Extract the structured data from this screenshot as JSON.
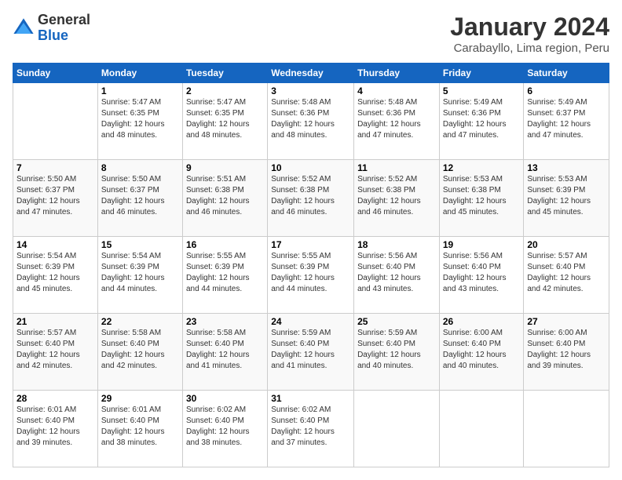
{
  "logo": {
    "line1": "General",
    "line2": "Blue"
  },
  "title": "January 2024",
  "subtitle": "Carabayllo, Lima region, Peru",
  "days_header": [
    "Sunday",
    "Monday",
    "Tuesday",
    "Wednesday",
    "Thursday",
    "Friday",
    "Saturday"
  ],
  "weeks": [
    [
      {
        "num": "",
        "info": ""
      },
      {
        "num": "1",
        "info": "Sunrise: 5:47 AM\nSunset: 6:35 PM\nDaylight: 12 hours\nand 48 minutes."
      },
      {
        "num": "2",
        "info": "Sunrise: 5:47 AM\nSunset: 6:35 PM\nDaylight: 12 hours\nand 48 minutes."
      },
      {
        "num": "3",
        "info": "Sunrise: 5:48 AM\nSunset: 6:36 PM\nDaylight: 12 hours\nand 48 minutes."
      },
      {
        "num": "4",
        "info": "Sunrise: 5:48 AM\nSunset: 6:36 PM\nDaylight: 12 hours\nand 47 minutes."
      },
      {
        "num": "5",
        "info": "Sunrise: 5:49 AM\nSunset: 6:36 PM\nDaylight: 12 hours\nand 47 minutes."
      },
      {
        "num": "6",
        "info": "Sunrise: 5:49 AM\nSunset: 6:37 PM\nDaylight: 12 hours\nand 47 minutes."
      }
    ],
    [
      {
        "num": "7",
        "info": "Sunrise: 5:50 AM\nSunset: 6:37 PM\nDaylight: 12 hours\nand 47 minutes."
      },
      {
        "num": "8",
        "info": "Sunrise: 5:50 AM\nSunset: 6:37 PM\nDaylight: 12 hours\nand 46 minutes."
      },
      {
        "num": "9",
        "info": "Sunrise: 5:51 AM\nSunset: 6:38 PM\nDaylight: 12 hours\nand 46 minutes."
      },
      {
        "num": "10",
        "info": "Sunrise: 5:52 AM\nSunset: 6:38 PM\nDaylight: 12 hours\nand 46 minutes."
      },
      {
        "num": "11",
        "info": "Sunrise: 5:52 AM\nSunset: 6:38 PM\nDaylight: 12 hours\nand 46 minutes."
      },
      {
        "num": "12",
        "info": "Sunrise: 5:53 AM\nSunset: 6:38 PM\nDaylight: 12 hours\nand 45 minutes."
      },
      {
        "num": "13",
        "info": "Sunrise: 5:53 AM\nSunset: 6:39 PM\nDaylight: 12 hours\nand 45 minutes."
      }
    ],
    [
      {
        "num": "14",
        "info": "Sunrise: 5:54 AM\nSunset: 6:39 PM\nDaylight: 12 hours\nand 45 minutes."
      },
      {
        "num": "15",
        "info": "Sunrise: 5:54 AM\nSunset: 6:39 PM\nDaylight: 12 hours\nand 44 minutes."
      },
      {
        "num": "16",
        "info": "Sunrise: 5:55 AM\nSunset: 6:39 PM\nDaylight: 12 hours\nand 44 minutes."
      },
      {
        "num": "17",
        "info": "Sunrise: 5:55 AM\nSunset: 6:39 PM\nDaylight: 12 hours\nand 44 minutes."
      },
      {
        "num": "18",
        "info": "Sunrise: 5:56 AM\nSunset: 6:40 PM\nDaylight: 12 hours\nand 43 minutes."
      },
      {
        "num": "19",
        "info": "Sunrise: 5:56 AM\nSunset: 6:40 PM\nDaylight: 12 hours\nand 43 minutes."
      },
      {
        "num": "20",
        "info": "Sunrise: 5:57 AM\nSunset: 6:40 PM\nDaylight: 12 hours\nand 42 minutes."
      }
    ],
    [
      {
        "num": "21",
        "info": "Sunrise: 5:57 AM\nSunset: 6:40 PM\nDaylight: 12 hours\nand 42 minutes."
      },
      {
        "num": "22",
        "info": "Sunrise: 5:58 AM\nSunset: 6:40 PM\nDaylight: 12 hours\nand 42 minutes."
      },
      {
        "num": "23",
        "info": "Sunrise: 5:58 AM\nSunset: 6:40 PM\nDaylight: 12 hours\nand 41 minutes."
      },
      {
        "num": "24",
        "info": "Sunrise: 5:59 AM\nSunset: 6:40 PM\nDaylight: 12 hours\nand 41 minutes."
      },
      {
        "num": "25",
        "info": "Sunrise: 5:59 AM\nSunset: 6:40 PM\nDaylight: 12 hours\nand 40 minutes."
      },
      {
        "num": "26",
        "info": "Sunrise: 6:00 AM\nSunset: 6:40 PM\nDaylight: 12 hours\nand 40 minutes."
      },
      {
        "num": "27",
        "info": "Sunrise: 6:00 AM\nSunset: 6:40 PM\nDaylight: 12 hours\nand 39 minutes."
      }
    ],
    [
      {
        "num": "28",
        "info": "Sunrise: 6:01 AM\nSunset: 6:40 PM\nDaylight: 12 hours\nand 39 minutes."
      },
      {
        "num": "29",
        "info": "Sunrise: 6:01 AM\nSunset: 6:40 PM\nDaylight: 12 hours\nand 38 minutes."
      },
      {
        "num": "30",
        "info": "Sunrise: 6:02 AM\nSunset: 6:40 PM\nDaylight: 12 hours\nand 38 minutes."
      },
      {
        "num": "31",
        "info": "Sunrise: 6:02 AM\nSunset: 6:40 PM\nDaylight: 12 hours\nand 37 minutes."
      },
      {
        "num": "",
        "info": ""
      },
      {
        "num": "",
        "info": ""
      },
      {
        "num": "",
        "info": ""
      }
    ]
  ]
}
